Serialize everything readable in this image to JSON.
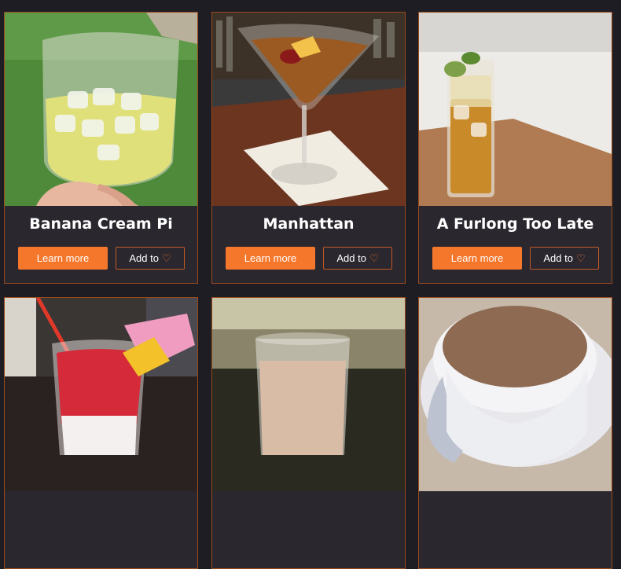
{
  "cards": [
    {
      "title": "Banana Cream Pi",
      "learn_label": "Learn more",
      "add_label": "Add to",
      "add_icon": "heart-outline-icon"
    },
    {
      "title": "Manhattan",
      "learn_label": "Learn more",
      "add_label": "Add to",
      "add_icon": "heart-outline-icon"
    },
    {
      "title": "A Furlong Too Late",
      "learn_label": "Learn more",
      "add_label": "Add to",
      "add_icon": "heart-outline-icon"
    },
    {
      "title": "",
      "learn_label": "",
      "add_label": ""
    },
    {
      "title": "",
      "learn_label": "",
      "add_label": ""
    },
    {
      "title": "",
      "learn_label": "",
      "add_label": ""
    }
  ],
  "colors": {
    "accent": "#f5772c",
    "background": "#1f1d24",
    "card": "#2a272f",
    "border": "#9a4a1c"
  }
}
